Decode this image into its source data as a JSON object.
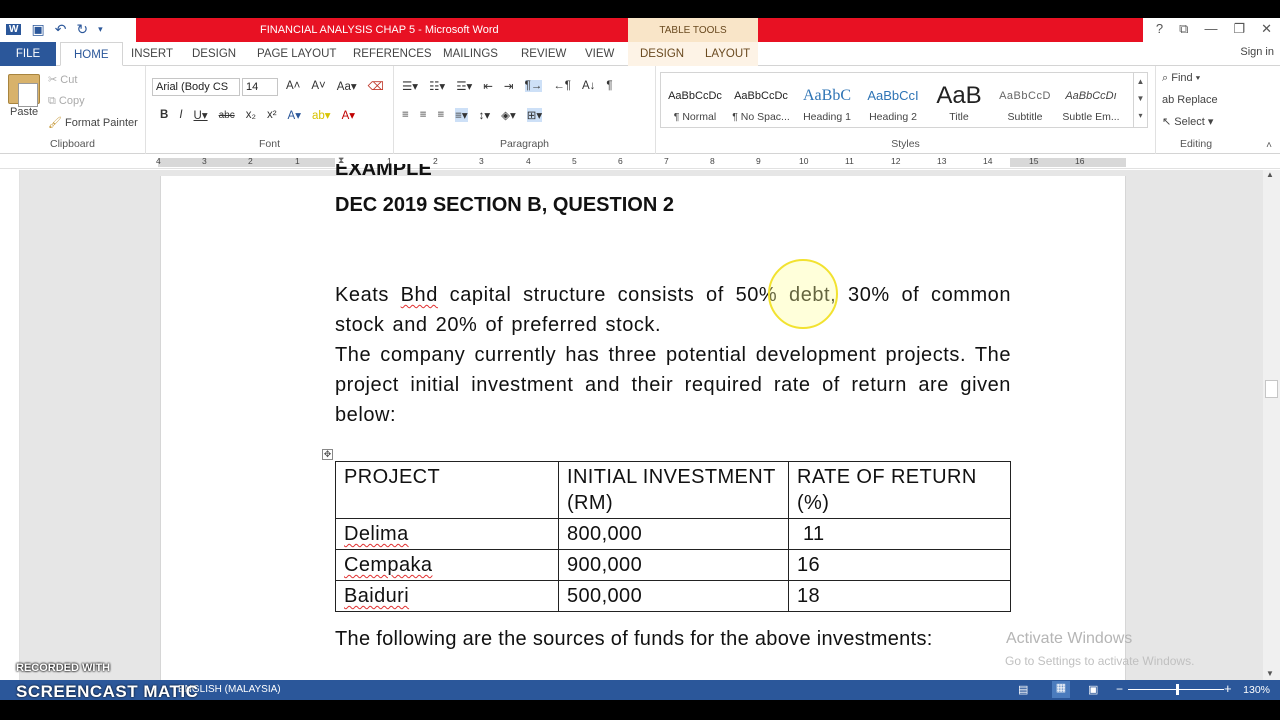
{
  "window": {
    "title": "FINANCIAL ANALYSIS CHAP 5 - Microsoft Word",
    "context_label": "TABLE TOOLS",
    "help": "?",
    "sign_in": "Sign in"
  },
  "tabs": [
    "FILE",
    "HOME",
    "INSERT",
    "DESIGN",
    "PAGE LAYOUT",
    "REFERENCES",
    "MAILINGS",
    "REVIEW",
    "VIEW"
  ],
  "context_tabs": [
    "DESIGN",
    "LAYOUT"
  ],
  "clipboard": {
    "paste": "Paste",
    "cut": "Cut",
    "copy": "Copy",
    "format_painter": "Format Painter",
    "group": "Clipboard"
  },
  "font": {
    "family": "Arial (Body CS",
    "size": "14",
    "group": "Font"
  },
  "paragraph": {
    "group": "Paragraph"
  },
  "styles": {
    "group": "Styles",
    "items": [
      {
        "preview": "AaBbCcDc",
        "name": "¶ Normal"
      },
      {
        "preview": "AaBbCcDc",
        "name": "¶ No Spac..."
      },
      {
        "preview": "AaBbC",
        "name": "Heading 1"
      },
      {
        "preview": "AaBbCcI",
        "name": "Heading 2"
      },
      {
        "preview": "AaB",
        "name": "Title"
      },
      {
        "preview": "AaBbCcD",
        "name": "Subtitle"
      },
      {
        "preview": "AaBbCcDı",
        "name": "Subtle Em..."
      }
    ]
  },
  "editing": {
    "find": "Find",
    "replace": "Replace",
    "select": "Select",
    "group": "Editing"
  },
  "ruler_numbers": [
    "4",
    "3",
    "2",
    "1",
    "1",
    "2",
    "3",
    "4",
    "5",
    "6",
    "7",
    "8",
    "9",
    "10",
    "11",
    "12",
    "13",
    "14",
    "15",
    "16"
  ],
  "document": {
    "heading_top": "EXAMPLE",
    "heading": "DEC 2019 SECTION B, QUESTION 2",
    "para1_a": "Keats ",
    "para1_b": "Bhd",
    "para1_c": " capital structure consists of 50% debt, 30% of common stock and 20% of preferred stock.",
    "para2": "The company currently has three potential development projects. The project initial investment and their required rate of return are given below:",
    "table": {
      "headers": [
        "PROJECT",
        "INITIAL INVESTMENT (RM)",
        "RATE OF RETURN (%)"
      ],
      "rows": [
        [
          "Delima",
          "800,000",
          " 11"
        ],
        [
          "Cempaka",
          "900,000",
          "16"
        ],
        [
          "Baiduri",
          "500,000",
          "18"
        ]
      ]
    },
    "para3": "The following are the sources of funds for the above investments:"
  },
  "watermark": {
    "line1": "Activate Windows",
    "line2": "Go to Settings to activate Windows."
  },
  "status": {
    "language": "ENGLISH (MALAYSIA)",
    "zoom": "130%"
  },
  "overlay": {
    "recorded": "RECORDED WITH",
    "brand": "SCREENCAST MATIC"
  }
}
